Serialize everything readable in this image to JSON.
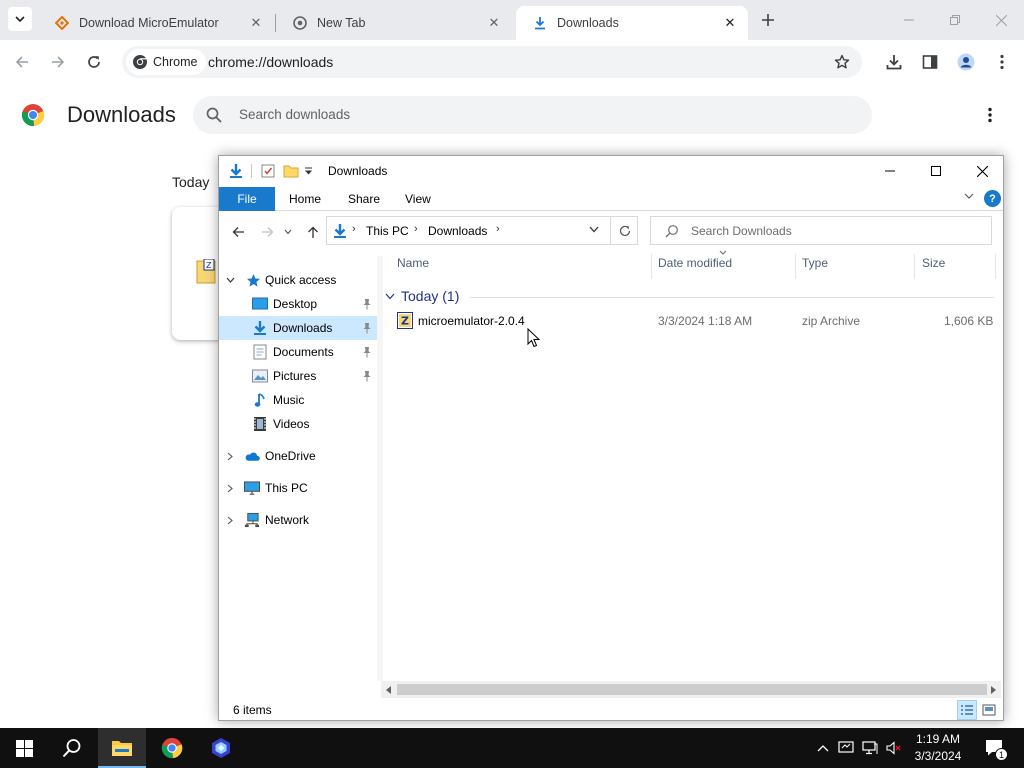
{
  "chrome": {
    "tabs": [
      {
        "title": "Download MicroEmulator",
        "icon": "microemulator-favicon"
      },
      {
        "title": "New Tab",
        "icon": "chrome-icon"
      },
      {
        "title": "Downloads",
        "icon": "download-icon",
        "active": true
      }
    ],
    "omnibox": {
      "chip_label": "Chrome",
      "url": "chrome://downloads"
    }
  },
  "downloads_page": {
    "title": "Downloads",
    "search_placeholder": "Search downloads",
    "date_group": "Today"
  },
  "explorer": {
    "title": "Downloads",
    "ribbon_tabs": [
      "File",
      "Home",
      "Share",
      "View"
    ],
    "breadcrumb": [
      "This PC",
      "Downloads"
    ],
    "search_placeholder": "Search Downloads",
    "nav_pane": {
      "quick_access": "Quick access",
      "items": [
        {
          "label": "Desktop",
          "icon": "desktop-icon",
          "pinned": true
        },
        {
          "label": "Downloads",
          "icon": "downloads-folder-icon",
          "pinned": true,
          "selected": true
        },
        {
          "label": "Documents",
          "icon": "documents-icon",
          "pinned": true
        },
        {
          "label": "Pictures",
          "icon": "pictures-icon",
          "pinned": true
        },
        {
          "label": "Music",
          "icon": "music-icon",
          "pinned": false
        },
        {
          "label": "Videos",
          "icon": "videos-icon",
          "pinned": false
        }
      ],
      "roots": [
        {
          "label": "OneDrive",
          "icon": "onedrive-icon"
        },
        {
          "label": "This PC",
          "icon": "this-pc-icon"
        },
        {
          "label": "Network",
          "icon": "network-icon"
        }
      ]
    },
    "columns": [
      "Name",
      "Date modified",
      "Type",
      "Size"
    ],
    "group": "Today (1)",
    "files": [
      {
        "name": "microemulator-2.0.4",
        "date_modified": "3/3/2024 1:18 AM",
        "type": "zip Archive",
        "size": "1,606 KB"
      }
    ],
    "status": "6 items"
  },
  "taskbar": {
    "time": "1:19 AM",
    "date": "3/3/2024",
    "notification_count": "1"
  },
  "colors": {
    "accent_blue": "#1979ca",
    "selection": "#cce8ff",
    "taskbar": "#101010"
  }
}
